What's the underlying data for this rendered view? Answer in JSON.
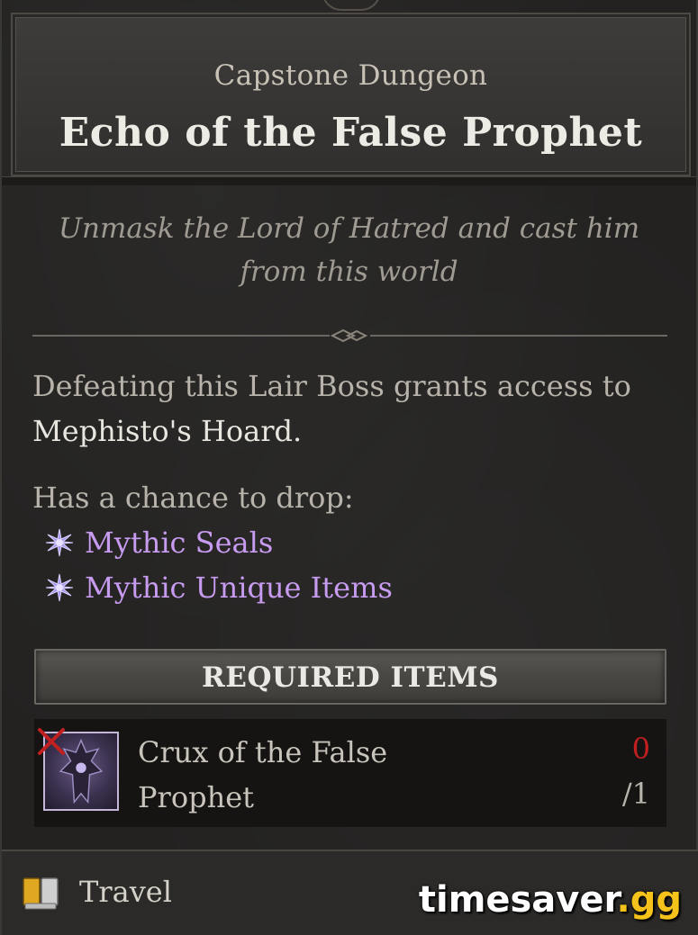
{
  "header": {
    "subtitle": "Capstone Dungeon",
    "title": "Echo of the False Prophet"
  },
  "flavor_text": {
    "line1": "Unmask the Lord of Hatred and cast him",
    "line2": "from this world"
  },
  "description": {
    "text": "Defeating this Lair Boss grants access to",
    "highlight": "Mephisto's Hoard."
  },
  "drops": {
    "label": "Has a chance to drop:",
    "items": [
      {
        "label": "Mythic Seals",
        "icon": "mythic-star-icon"
      },
      {
        "label": "Mythic Unique Items",
        "icon": "mythic-star-icon"
      }
    ]
  },
  "required_items": {
    "header": "REQUIRED ITEMS",
    "items": [
      {
        "name_line1": "Crux of the False",
        "name_line2": "Prophet",
        "have": "0",
        "need": "/1",
        "icon": "crux-item-icon",
        "missing_marker": "red-x-icon"
      }
    ]
  },
  "footer": {
    "action_label": "Travel",
    "action_icon": "map-book-icon"
  },
  "watermark": {
    "text": "timesaver",
    "tld": ".gg"
  },
  "colors": {
    "mythic": "#c79bf0",
    "missing": "#c21f1f",
    "watermark_accent": "#f4c21a"
  }
}
